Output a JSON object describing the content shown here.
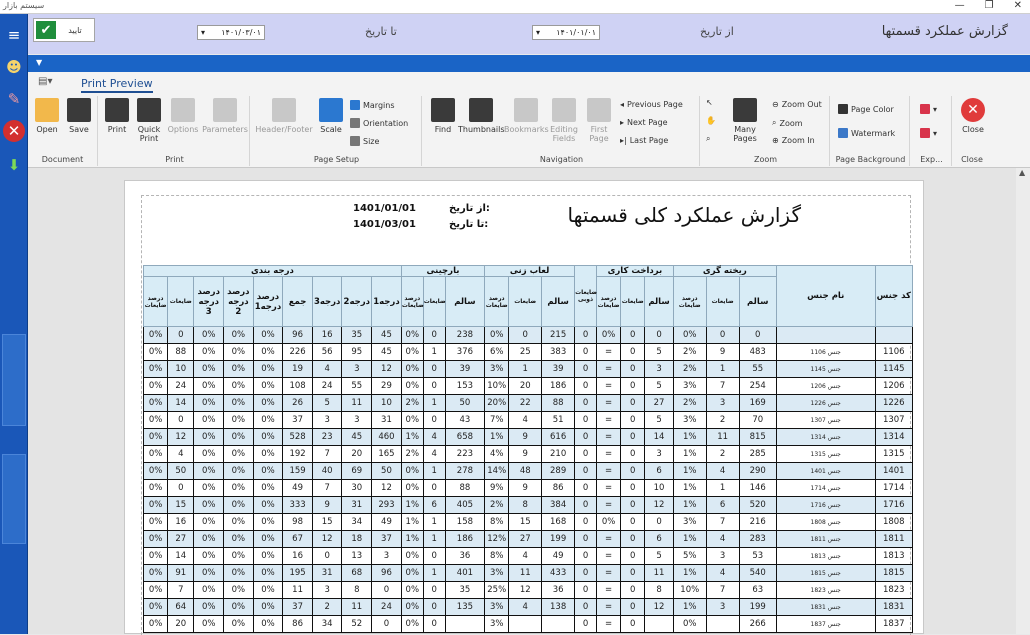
{
  "window": {
    "title": "سیستم بازار",
    "controls": [
      "—",
      "❐",
      "✕"
    ]
  },
  "filters": {
    "ok_label": "تایید",
    "from_label": "از تاریخ",
    "from_value": "۱۴۰۱/۰۱/۰۱",
    "to_label": "تا تاریخ",
    "to_value": "۱۴۰۱/۰۳/۰۱",
    "report_title": "گزارش عملکرد قسمتها"
  },
  "ribbon": {
    "tab": "Print Preview",
    "groups": {
      "document": {
        "label": "Document",
        "open": "Open",
        "save": "Save"
      },
      "print": {
        "label": "Print",
        "print": "Print",
        "quick_print": "Quick Print",
        "options": "Options",
        "parameters": "Parameters"
      },
      "page_setup": {
        "label": "Page Setup",
        "header_footer": "Header/Footer",
        "scale": "Scale",
        "margins": "Margins",
        "orientation": "Orientation",
        "size": "Size"
      },
      "navigation": {
        "label": "Navigation",
        "find": "Find",
        "thumbnails": "Thumbnails",
        "bookmarks": "Bookmarks",
        "editing_fields": "Editing Fields",
        "first_page": "First Page",
        "previous_page": "Previous Page",
        "next_page": "Next Page",
        "last_page": "Last Page"
      },
      "zoom": {
        "label": "Zoom",
        "many_pages": "Many Pages",
        "zoom_out": "Zoom Out",
        "zoom": "Zoom",
        "zoom_in": "Zoom In"
      },
      "page_background": {
        "label": "Page Background",
        "page_color": "Page Color",
        "watermark": "Watermark"
      },
      "export": {
        "label": "Exp..."
      },
      "close": {
        "label": "Close",
        "close": "Close"
      }
    }
  },
  "report": {
    "title": "گزارش عملکرد کلی قسمتها",
    "from_label": "از تاریخ:",
    "from_value": "1401/01/01",
    "to_label": "تا تاریخ:",
    "to_value": "1401/03/01",
    "group_headers": {
      "code": "کد جنس",
      "name": "نام جنس",
      "casting": "ریخته گری",
      "machining": "برداخت کاری",
      "waste": "ضایعات ذوبی",
      "polish": "لعاب زنی",
      "sorting": "بارچینی",
      "grading": "درجه بندی"
    },
    "sub_headers": {
      "casting": [
        "درصد ضایعات",
        "ضایعات",
        "سالم"
      ],
      "machining": [
        "درصد ضایعات",
        "ضایعات",
        "سالم"
      ],
      "polish": [
        "درصد ضایعات",
        "ضایعات",
        "سالم"
      ],
      "sorting": [
        "درصد ضایعات",
        "ضایعات",
        "سالم"
      ],
      "grading": [
        "درصد ضایعات",
        "ضایعات",
        "درصد درجه 3",
        "درصد درجه 2",
        "درصد درجه1",
        "جمع",
        "درجه3",
        "درجه2",
        "درجه1"
      ]
    },
    "rows": [
      {
        "code": "",
        "name": "",
        "c": [
          "0",
          "0",
          "0%"
        ],
        "m": [
          "0",
          "0",
          "0%"
        ],
        "w": "0",
        "p": [
          "215",
          "0",
          "0%"
        ],
        "s": [
          "238",
          "0",
          "0%"
        ],
        "g": [
          "45",
          "35",
          "16",
          "96",
          "0%",
          "0%",
          "0%",
          "0",
          "0%"
        ]
      },
      {
        "code": "1106",
        "name": "جنس 1106",
        "c": [
          "483",
          "9",
          "2%"
        ],
        "m": [
          "5",
          "0",
          "="
        ],
        "w": "0",
        "p": [
          "383",
          "25",
          "6%"
        ],
        "s": [
          "376",
          "1",
          "0%"
        ],
        "g": [
          "45",
          "95",
          "56",
          "226",
          "0%",
          "0%",
          "0%",
          "88",
          "0%"
        ]
      },
      {
        "code": "1145",
        "name": "جنس 1145",
        "c": [
          "55",
          "1",
          "2%"
        ],
        "m": [
          "3",
          "0",
          "="
        ],
        "w": "0",
        "p": [
          "39",
          "1",
          "3%"
        ],
        "s": [
          "39",
          "0",
          "0%"
        ],
        "g": [
          "12",
          "3",
          "4",
          "19",
          "0%",
          "0%",
          "0%",
          "10",
          "0%"
        ]
      },
      {
        "code": "1206",
        "name": "جنس 1206",
        "c": [
          "254",
          "7",
          "3%"
        ],
        "m": [
          "5",
          "0",
          "="
        ],
        "w": "0",
        "p": [
          "186",
          "20",
          "10%"
        ],
        "s": [
          "153",
          "0",
          "0%"
        ],
        "g": [
          "29",
          "55",
          "24",
          "108",
          "0%",
          "0%",
          "0%",
          "24",
          "0%"
        ]
      },
      {
        "code": "1226",
        "name": "جنس 1226",
        "c": [
          "169",
          "3",
          "2%"
        ],
        "m": [
          "27",
          "0",
          "="
        ],
        "w": "0",
        "p": [
          "88",
          "22",
          "20%"
        ],
        "s": [
          "50",
          "1",
          "2%"
        ],
        "g": [
          "10",
          "11",
          "5",
          "26",
          "0%",
          "0%",
          "0%",
          "14",
          "0%"
        ]
      },
      {
        "code": "1307",
        "name": "جنس 1307",
        "c": [
          "70",
          "2",
          "3%"
        ],
        "m": [
          "5",
          "0",
          "="
        ],
        "w": "0",
        "p": [
          "51",
          "4",
          "7%"
        ],
        "s": [
          "43",
          "0",
          "0%"
        ],
        "g": [
          "31",
          "3",
          "3",
          "37",
          "0%",
          "0%",
          "0%",
          "0",
          "0%"
        ]
      },
      {
        "code": "1314",
        "name": "جنس 1314",
        "c": [
          "815",
          "11",
          "1%"
        ],
        "m": [
          "14",
          "0",
          "="
        ],
        "w": "0",
        "p": [
          "616",
          "9",
          "1%"
        ],
        "s": [
          "658",
          "4",
          "1%"
        ],
        "g": [
          "460",
          "45",
          "23",
          "528",
          "0%",
          "0%",
          "0%",
          "12",
          "0%"
        ]
      },
      {
        "code": "1315",
        "name": "جنس 1315",
        "c": [
          "285",
          "2",
          "1%"
        ],
        "m": [
          "3",
          "0",
          "="
        ],
        "w": "0",
        "p": [
          "210",
          "9",
          "4%"
        ],
        "s": [
          "223",
          "4",
          "2%"
        ],
        "g": [
          "165",
          "20",
          "7",
          "192",
          "0%",
          "0%",
          "0%",
          "4",
          "0%"
        ]
      },
      {
        "code": "1401",
        "name": "جنس 1401",
        "c": [
          "290",
          "4",
          "1%"
        ],
        "m": [
          "6",
          "0",
          "="
        ],
        "w": "0",
        "p": [
          "289",
          "48",
          "14%"
        ],
        "s": [
          "278",
          "1",
          "0%"
        ],
        "g": [
          "50",
          "69",
          "40",
          "159",
          "0%",
          "0%",
          "0%",
          "50",
          "0%"
        ]
      },
      {
        "code": "1714",
        "name": "جنس 1714",
        "c": [
          "146",
          "1",
          "1%"
        ],
        "m": [
          "10",
          "0",
          "="
        ],
        "w": "0",
        "p": [
          "86",
          "9",
          "9%"
        ],
        "s": [
          "88",
          "0",
          "0%"
        ],
        "g": [
          "12",
          "30",
          "7",
          "49",
          "0%",
          "0%",
          "0%",
          "0",
          "0%"
        ]
      },
      {
        "code": "1716",
        "name": "جنس 1716",
        "c": [
          "520",
          "6",
          "1%"
        ],
        "m": [
          "12",
          "0",
          "="
        ],
        "w": "0",
        "p": [
          "384",
          "8",
          "2%"
        ],
        "s": [
          "405",
          "6",
          "1%"
        ],
        "g": [
          "293",
          "31",
          "9",
          "333",
          "0%",
          "0%",
          "0%",
          "15",
          "0%"
        ]
      },
      {
        "code": "1808",
        "name": "جنس 1808",
        "c": [
          "216",
          "7",
          "3%"
        ],
        "m": [
          "0",
          "0",
          "0%"
        ],
        "w": "0",
        "p": [
          "168",
          "15",
          "8%"
        ],
        "s": [
          "158",
          "1",
          "1%"
        ],
        "g": [
          "49",
          "34",
          "15",
          "98",
          "0%",
          "0%",
          "0%",
          "16",
          "0%"
        ]
      },
      {
        "code": "1811",
        "name": "جنس 1811",
        "c": [
          "283",
          "4",
          "1%"
        ],
        "m": [
          "6",
          "0",
          "="
        ],
        "w": "0",
        "p": [
          "199",
          "27",
          "12%"
        ],
        "s": [
          "186",
          "1",
          "1%"
        ],
        "g": [
          "37",
          "18",
          "12",
          "67",
          "0%",
          "0%",
          "0%",
          "27",
          "0%"
        ]
      },
      {
        "code": "1813",
        "name": "جنس 1813",
        "c": [
          "53",
          "3",
          "5%"
        ],
        "m": [
          "5",
          "0",
          "="
        ],
        "w": "0",
        "p": [
          "49",
          "4",
          "8%"
        ],
        "s": [
          "36",
          "0",
          "0%"
        ],
        "g": [
          "3",
          "13",
          "0",
          "16",
          "0%",
          "0%",
          "0%",
          "14",
          "0%"
        ]
      },
      {
        "code": "1815",
        "name": "جنس 1815",
        "c": [
          "540",
          "4",
          "1%"
        ],
        "m": [
          "11",
          "0",
          "="
        ],
        "w": "0",
        "p": [
          "433",
          "11",
          "3%"
        ],
        "s": [
          "401",
          "1",
          "0%"
        ],
        "g": [
          "96",
          "68",
          "31",
          "195",
          "0%",
          "0%",
          "0%",
          "91",
          "0%"
        ]
      },
      {
        "code": "1823",
        "name": "جنس 1823",
        "c": [
          "63",
          "7",
          "10%"
        ],
        "m": [
          "8",
          "0",
          "="
        ],
        "w": "0",
        "p": [
          "36",
          "12",
          "25%"
        ],
        "s": [
          "35",
          "0",
          "0%"
        ],
        "g": [
          "0",
          "8",
          "3",
          "11",
          "0%",
          "0%",
          "0%",
          "7",
          "0%"
        ]
      },
      {
        "code": "1831",
        "name": "جنس 1831",
        "c": [
          "199",
          "3",
          "1%"
        ],
        "m": [
          "12",
          "0",
          "="
        ],
        "w": "0",
        "p": [
          "138",
          "4",
          "3%"
        ],
        "s": [
          "135",
          "0",
          "0%"
        ],
        "g": [
          "24",
          "11",
          "2",
          "37",
          "0%",
          "0%",
          "0%",
          "64",
          "0%"
        ]
      },
      {
        "code": "1837",
        "name": "جنس 1837",
        "c": [
          "266",
          "",
          "0%"
        ],
        "m": [
          "",
          "0",
          "="
        ],
        "w": "0",
        "p": [
          "",
          "",
          "3%"
        ],
        "s": [
          "",
          "0",
          "0%"
        ],
        "g": [
          "0",
          "52",
          "34",
          "86",
          "0%",
          "0%",
          "0%",
          "20",
          "0%"
        ]
      }
    ]
  }
}
